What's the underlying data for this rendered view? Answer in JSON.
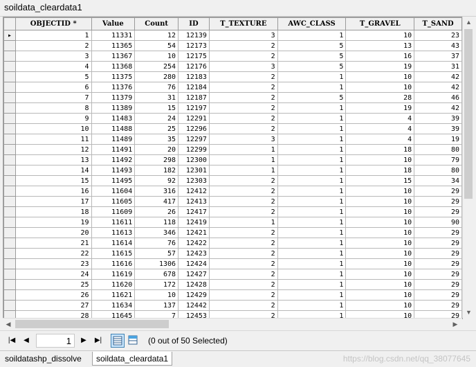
{
  "window": {
    "title": "soildata_cleardata1"
  },
  "table": {
    "columns": [
      "OBJECTID *",
      "Value",
      "Count",
      "ID",
      "T_TEXTURE",
      "AWC_CLASS",
      "T_GRAVEL",
      "T_SAND"
    ],
    "current_row_marker": "▸",
    "rows": [
      [
        "1",
        "11331",
        "12",
        "12139",
        "3",
        "1",
        "10",
        "23"
      ],
      [
        "2",
        "11365",
        "54",
        "12173",
        "2",
        "5",
        "13",
        "43"
      ],
      [
        "3",
        "11367",
        "10",
        "12175",
        "2",
        "5",
        "16",
        "37"
      ],
      [
        "4",
        "11368",
        "254",
        "12176",
        "3",
        "5",
        "19",
        "31"
      ],
      [
        "5",
        "11375",
        "280",
        "12183",
        "2",
        "1",
        "10",
        "42"
      ],
      [
        "6",
        "11376",
        "76",
        "12184",
        "2",
        "1",
        "10",
        "42"
      ],
      [
        "7",
        "11379",
        "31",
        "12187",
        "2",
        "5",
        "28",
        "46"
      ],
      [
        "8",
        "11389",
        "15",
        "12197",
        "2",
        "1",
        "19",
        "42"
      ],
      [
        "9",
        "11483",
        "24",
        "12291",
        "2",
        "1",
        "4",
        "39"
      ],
      [
        "10",
        "11488",
        "25",
        "12296",
        "2",
        "1",
        "4",
        "39"
      ],
      [
        "11",
        "11489",
        "35",
        "12297",
        "3",
        "1",
        "4",
        "19"
      ],
      [
        "12",
        "11491",
        "20",
        "12299",
        "1",
        "1",
        "18",
        "80"
      ],
      [
        "13",
        "11492",
        "298",
        "12300",
        "1",
        "1",
        "10",
        "79"
      ],
      [
        "14",
        "11493",
        "182",
        "12301",
        "1",
        "1",
        "18",
        "80"
      ],
      [
        "15",
        "11495",
        "92",
        "12303",
        "2",
        "1",
        "15",
        "34"
      ],
      [
        "16",
        "11604",
        "316",
        "12412",
        "2",
        "1",
        "10",
        "29"
      ],
      [
        "17",
        "11605",
        "417",
        "12413",
        "2",
        "1",
        "10",
        "29"
      ],
      [
        "18",
        "11609",
        "26",
        "12417",
        "2",
        "1",
        "10",
        "29"
      ],
      [
        "19",
        "11611",
        "118",
        "12419",
        "1",
        "1",
        "10",
        "90"
      ],
      [
        "20",
        "11613",
        "346",
        "12421",
        "2",
        "1",
        "10",
        "29"
      ],
      [
        "21",
        "11614",
        "76",
        "12422",
        "2",
        "1",
        "10",
        "29"
      ],
      [
        "22",
        "11615",
        "57",
        "12423",
        "2",
        "1",
        "10",
        "29"
      ],
      [
        "23",
        "11616",
        "1306",
        "12424",
        "2",
        "1",
        "10",
        "29"
      ],
      [
        "24",
        "11619",
        "678",
        "12427",
        "2",
        "1",
        "10",
        "29"
      ],
      [
        "25",
        "11620",
        "172",
        "12428",
        "2",
        "1",
        "10",
        "29"
      ],
      [
        "26",
        "11621",
        "10",
        "12429",
        "2",
        "1",
        "10",
        "29"
      ],
      [
        "27",
        "11634",
        "137",
        "12442",
        "2",
        "1",
        "10",
        "29"
      ],
      [
        "28",
        "11645",
        "7",
        "12453",
        "2",
        "1",
        "10",
        "29"
      ]
    ]
  },
  "scrollbars": {
    "up": "▲",
    "down": "▼",
    "left": "◀",
    "right": "▶"
  },
  "navigation": {
    "first": "|◀",
    "prev": "◀",
    "next": "▶",
    "last": "▶|",
    "current_record": "1",
    "selection_status": "(0 out of 50 Selected)"
  },
  "tabs": [
    {
      "label": "soildatashp_dissolve",
      "active": false
    },
    {
      "label": "soildata_cleardata1",
      "active": true
    }
  ],
  "watermark": "https://blog.csdn.net/qq_38077645"
}
